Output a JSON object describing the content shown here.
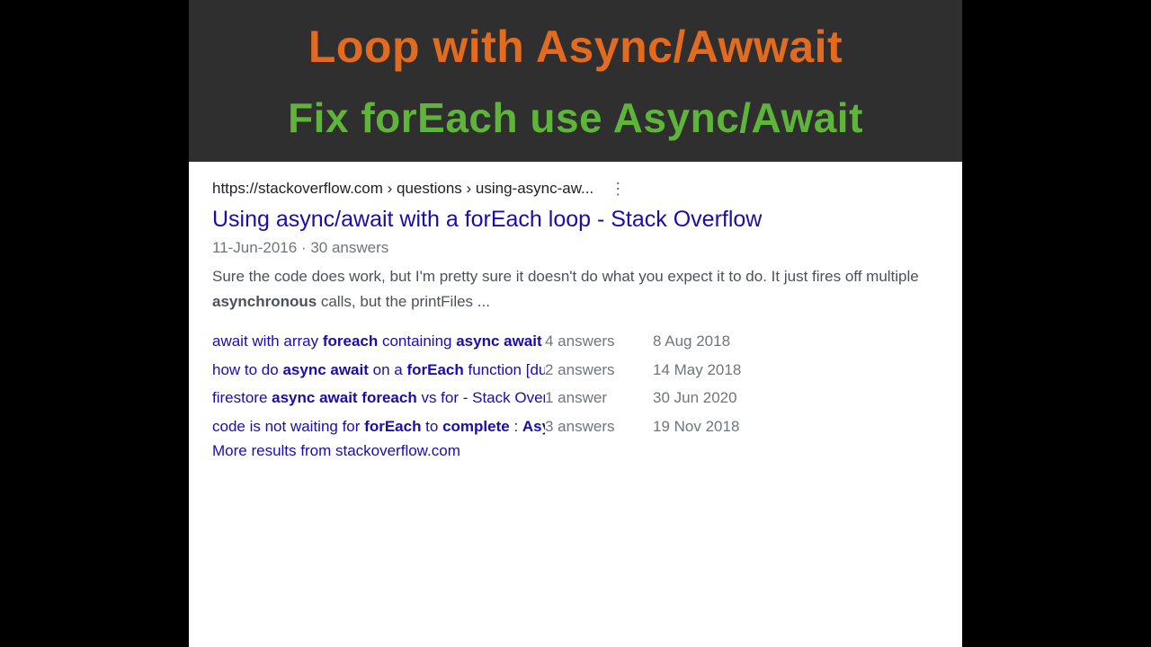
{
  "hero": {
    "line1": "Loop with Async/Awwait",
    "line2": "Fix forEach use Async/Await"
  },
  "result": {
    "breadcrumb": "https://stackoverflow.com › questions › using-async-aw...",
    "title": "Using async/await with a forEach loop - Stack Overflow",
    "date": "11-Jun-2016",
    "answers_label": "30 answers",
    "snippet_pre": "Sure the code does work, but I'm pretty sure it doesn't do what you expect it to do. It just fires off multiple ",
    "snippet_bold": "asynchronous",
    "snippet_post": " calls, but the printFiles ..."
  },
  "related": [
    {
      "link_html": "await with array <b>foreach</b> containing <b>async await</b> ...",
      "answers": "4 answers",
      "date": "8 Aug 2018"
    },
    {
      "link_html": "how to do <b>async await</b> on a <b>forEach</b> function [duplicate ...",
      "answers": "2 answers",
      "date": "14 May 2018"
    },
    {
      "link_html": "firestore <b>async await foreach</b> vs for - Stack Overflow",
      "answers": "1 answer",
      "date": "30 Jun 2020"
    },
    {
      "link_html": "code is not waiting for <b>forEach</b> to <b>complete</b> : <b>Async</b> ...",
      "answers": "3 answers",
      "date": "19 Nov 2018"
    }
  ],
  "more_results": "More results from stackoverflow.com"
}
